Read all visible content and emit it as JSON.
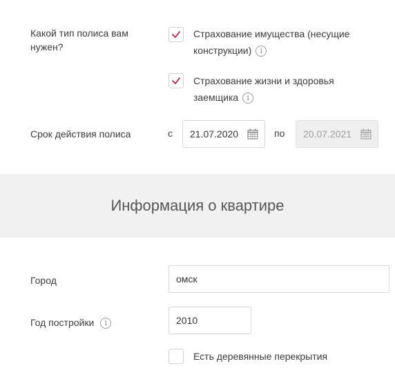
{
  "policy_type": {
    "label": "Какой тип полиса вам нужен?",
    "options": [
      {
        "label_line1": "Страхование имущества (несущие",
        "label_line2": "конструкции)",
        "checked": true,
        "info_icon": "info-icon"
      },
      {
        "label_line1": "Страхование жизни и здоровья",
        "label_line2": "заемщика",
        "checked": true,
        "info_icon": "info-icon"
      }
    ]
  },
  "validity": {
    "label": "Срок действия полиса",
    "from_label": "с",
    "from_value": "21.07.2020",
    "to_label": "по",
    "to_value": "20.07.2021",
    "to_disabled": true,
    "calendar_icon": "calendar-icon"
  },
  "section": {
    "title": "Информация о квартире"
  },
  "apartment": {
    "city_label": "Город",
    "city_value": "омск",
    "year_label": "Год постройки",
    "year_value": "2010",
    "wooden_floors_label": "Есть деревянные перекрытия",
    "wooden_floors_checked": false
  },
  "colors": {
    "check_mark": "#b0254a",
    "band_bg": "#f1f1f1",
    "disabled_input_bg": "#efefef"
  }
}
